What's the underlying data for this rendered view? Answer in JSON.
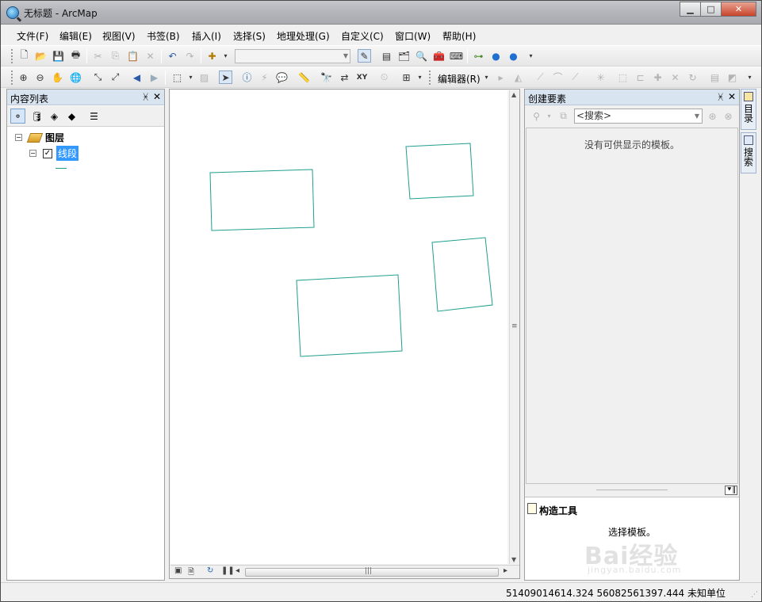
{
  "window": {
    "title": "无标题 - ArcMap"
  },
  "menu": [
    "文件(F)",
    "编辑(E)",
    "视图(V)",
    "书签(B)",
    "插入(I)",
    "选择(S)",
    "地理处理(G)",
    "自定义(C)",
    "窗口(W)",
    "帮助(H)"
  ],
  "toolbar": {
    "scale_value": "",
    "editor_label": "编辑器(R)"
  },
  "toc": {
    "title": "内容列表",
    "root_label": "图层",
    "layer_label": "线段",
    "layer_checked": true
  },
  "create_features": {
    "title": "创建要素",
    "search_placeholder": "<搜索>",
    "empty_message": "没有可供显示的模板。",
    "construct_title": "构造工具",
    "construct_message": "选择模板。"
  },
  "side_tabs": [
    "目录",
    "搜索"
  ],
  "status": {
    "coordinates": "51409014614.324  56082561397.444 未知单位"
  },
  "map": {
    "feature_color": "#1f9e8e",
    "feature_count": 4
  },
  "watermark": {
    "brand": "Bai经验",
    "url": "jingyan.baidu.com"
  }
}
